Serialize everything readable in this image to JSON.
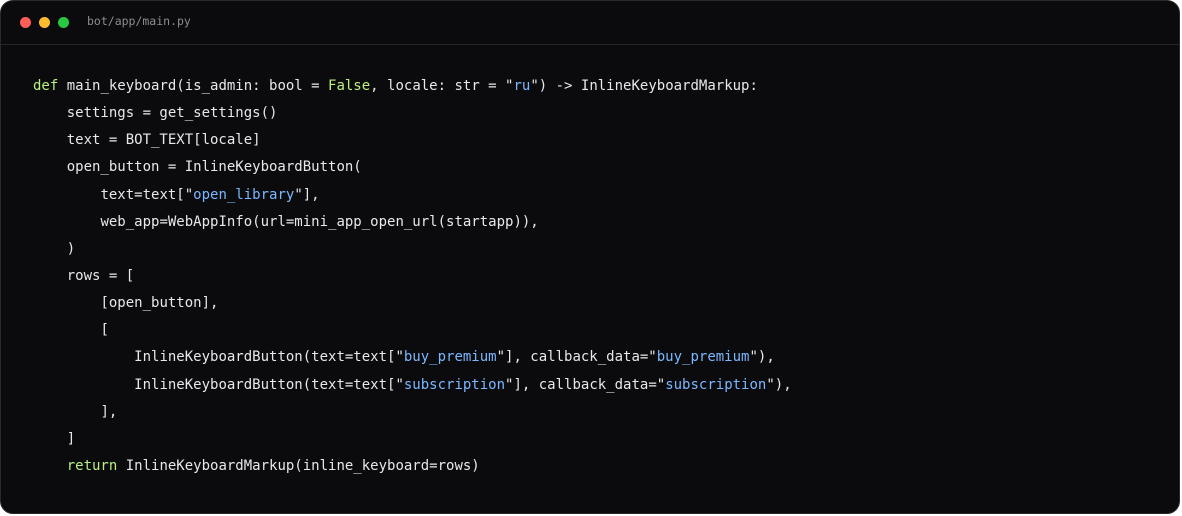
{
  "window": {
    "title": "bot/app/main.py",
    "traffic_lights": [
      {
        "name": "close",
        "color": "#ff5f57"
      },
      {
        "name": "minimize",
        "color": "#febc2e"
      },
      {
        "name": "zoom",
        "color": "#28c840"
      }
    ]
  },
  "theme": {
    "keyword": "#b9f27c",
    "string": "#79b8ff",
    "text": "#e8e8ea"
  },
  "code": {
    "lines": [
      {
        "indent": 0,
        "tokens": [
          {
            "t": "def",
            "k": "kw"
          },
          {
            "t": " main_keyboard(is_admin: bool = "
          },
          {
            "t": "False",
            "k": "kw"
          },
          {
            "t": ", locale: str = \""
          },
          {
            "t": "ru",
            "k": "str"
          },
          {
            "t": "\") -> InlineKeyboardMarkup:"
          }
        ]
      },
      {
        "indent": 1,
        "tokens": [
          {
            "t": "settings = get_settings()"
          }
        ]
      },
      {
        "indent": 1,
        "tokens": [
          {
            "t": "text = BOT_TEXT[locale]"
          }
        ]
      },
      {
        "indent": 1,
        "tokens": [
          {
            "t": "open_button = InlineKeyboardButton("
          }
        ]
      },
      {
        "indent": 2,
        "tokens": [
          {
            "t": "text=text[\""
          },
          {
            "t": "open_library",
            "k": "str"
          },
          {
            "t": "\"],"
          }
        ]
      },
      {
        "indent": 2,
        "tokens": [
          {
            "t": "web_app=WebAppInfo(url=mini_app_open_url(startapp)),"
          }
        ]
      },
      {
        "indent": 1,
        "tokens": [
          {
            "t": ")"
          }
        ]
      },
      {
        "indent": 1,
        "tokens": [
          {
            "t": "rows = ["
          }
        ]
      },
      {
        "indent": 2,
        "tokens": [
          {
            "t": "[open_button],"
          }
        ]
      },
      {
        "indent": 2,
        "tokens": [
          {
            "t": "["
          }
        ]
      },
      {
        "indent": 3,
        "tokens": [
          {
            "t": "InlineKeyboardButton(text=text[\""
          },
          {
            "t": "buy_premium",
            "k": "str"
          },
          {
            "t": "\"], callback_data=\""
          },
          {
            "t": "buy_premium",
            "k": "str"
          },
          {
            "t": "\"),"
          }
        ]
      },
      {
        "indent": 3,
        "tokens": [
          {
            "t": "InlineKeyboardButton(text=text[\""
          },
          {
            "t": "subscription",
            "k": "str"
          },
          {
            "t": "\"], callback_data=\""
          },
          {
            "t": "subscription",
            "k": "str"
          },
          {
            "t": "\"),"
          }
        ]
      },
      {
        "indent": 2,
        "tokens": [
          {
            "t": "],"
          }
        ]
      },
      {
        "indent": 1,
        "tokens": [
          {
            "t": "]"
          }
        ]
      },
      {
        "indent": 1,
        "tokens": [
          {
            "t": "return",
            "k": "kw"
          },
          {
            "t": " InlineKeyboardMarkup(inline_keyboard=rows)"
          }
        ]
      }
    ]
  }
}
